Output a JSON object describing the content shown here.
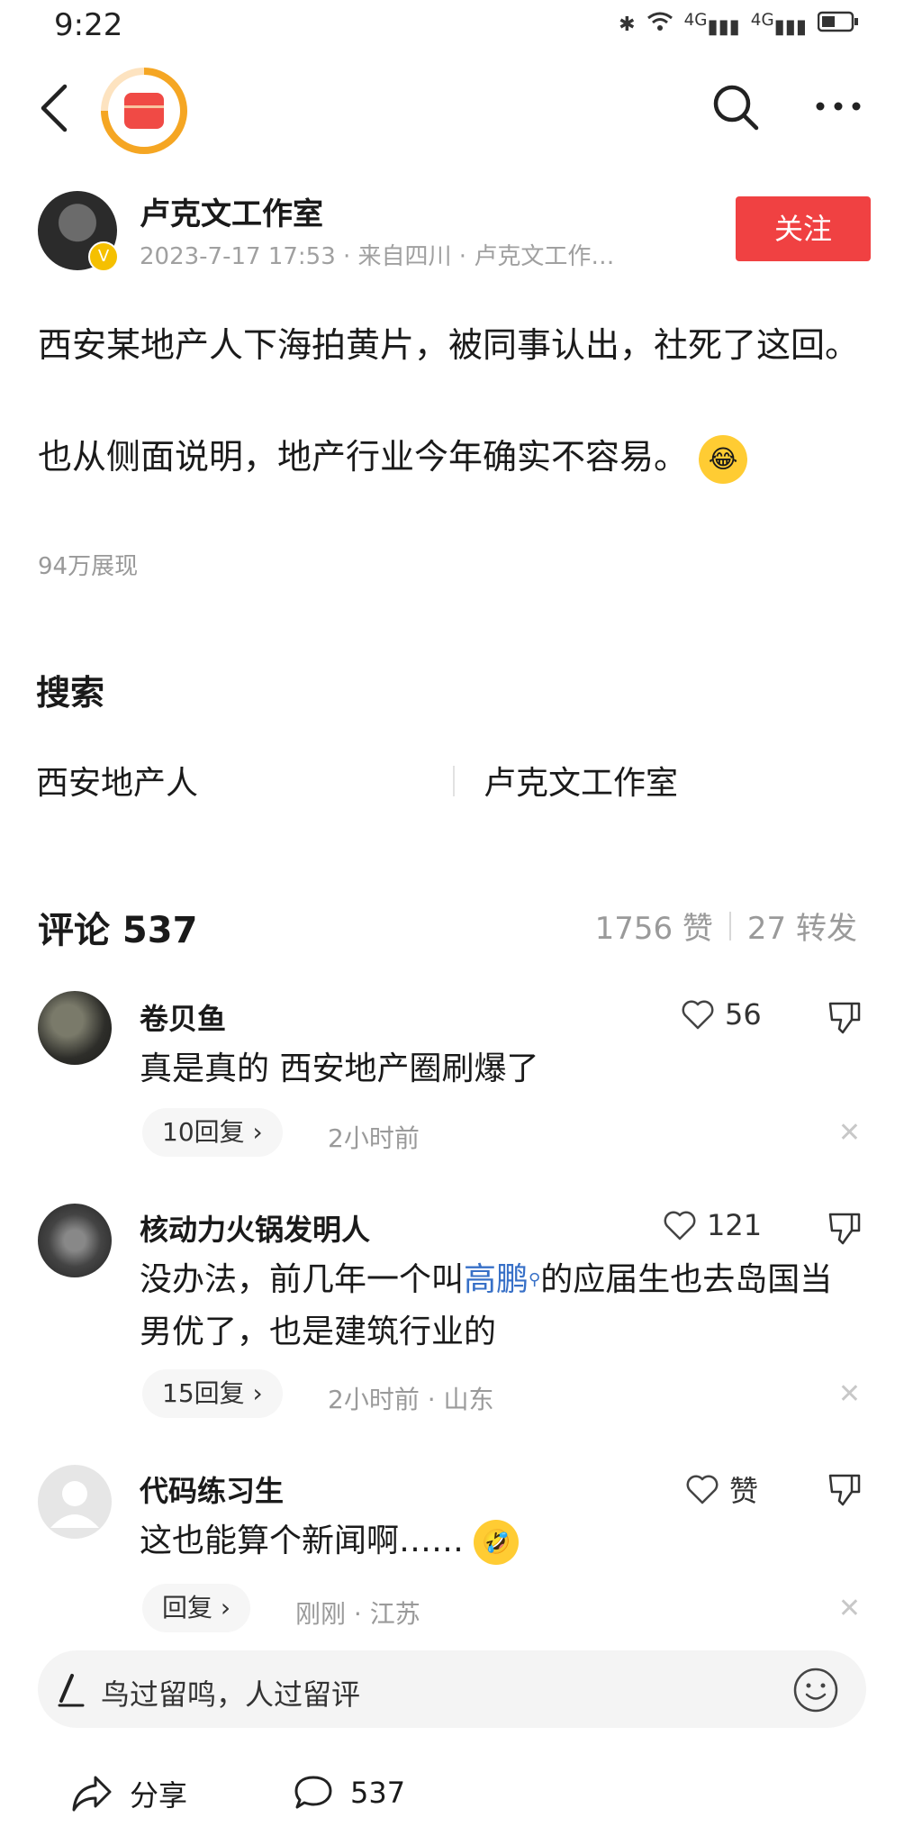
{
  "status_bar": {
    "time": "9:22",
    "signal1": "4G",
    "signal2": "4G"
  },
  "author": {
    "name": "卢克文工作室",
    "meta": "2023-7-17 17:53 · 来自四川 · 卢克文工作…",
    "follow_label": "关注"
  },
  "post": {
    "line1": "西安某地产人下海拍黄片，被同事认出，社死了这回。",
    "line2": "也从侧面说明，地产行业今年确实不容易。",
    "views": "94万展现"
  },
  "search": {
    "title": "搜索",
    "items": [
      "西安地产人",
      "卢克文工作室"
    ]
  },
  "comments_header": {
    "title": "评论 537",
    "likes": "1756 赞",
    "shares": "27 转发"
  },
  "comments": [
    {
      "name": "卷贝鱼",
      "text": "真是真的 西安地产圈刷爆了",
      "likes": "56",
      "replies": "10回复 ›",
      "time": "2小时前"
    },
    {
      "name": "核动力火锅发明人",
      "text_before": "没办法，前几年一个叫",
      "link": "高鹏",
      "text_after": "的应届生也去岛国当男优了，也是建筑行业的",
      "likes": "121",
      "replies": "15回复 ›",
      "time": "2小时前 · 山东"
    },
    {
      "name": "代码练习生",
      "text": "这也能算个新闻啊……",
      "likes": "赞",
      "replies": "回复 ›",
      "time": "刚刚 · 江苏"
    }
  ],
  "input": {
    "placeholder": "鸟过留鸣，人过留评"
  },
  "bottom": {
    "share_label": "分享",
    "comment_count": "537"
  }
}
